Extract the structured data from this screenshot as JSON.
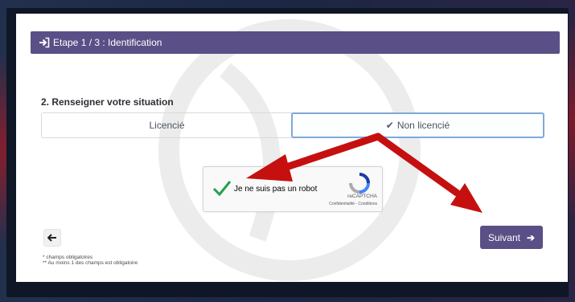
{
  "header": {
    "title": "Etape 1 / 3 : Identification"
  },
  "section": {
    "title": "2. Renseigner votre situation"
  },
  "status_options": [
    {
      "label": "Licencié",
      "selected": false
    },
    {
      "label": "Non licencié",
      "selected": true
    }
  ],
  "captcha": {
    "label": "Je ne suis pas un robot",
    "brand": "reCAPTCHA",
    "links": "Confidentialité - Conditions",
    "checked": true
  },
  "buttons": {
    "next_label": "Suivant"
  },
  "notes": [
    "* champs obligatoires",
    "** Au moins 1 des champs est obligatoire"
  ],
  "colors": {
    "primary": "#5a4f86",
    "check": "#25a14a",
    "annotation_arrow": "#c5100f"
  }
}
